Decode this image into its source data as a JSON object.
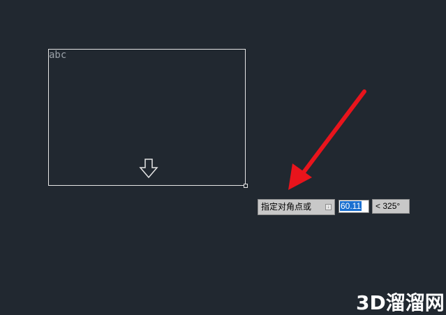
{
  "drawing": {
    "mtext_sample": "abc"
  },
  "dynamic_input": {
    "prompt": "指定对角点或",
    "distance_value": "60.11",
    "angle_value": "< 325°"
  },
  "watermark": {
    "text": "3D溜溜网"
  },
  "colors": {
    "background": "#212830",
    "annotation_arrow": "#e8141c",
    "selection": "#1a6fd0"
  },
  "icons": {
    "arrow_down": "arrow-down-outline-icon",
    "corner_grip": "grip-square-icon",
    "prompt_options": "dropdown-options-icon"
  }
}
